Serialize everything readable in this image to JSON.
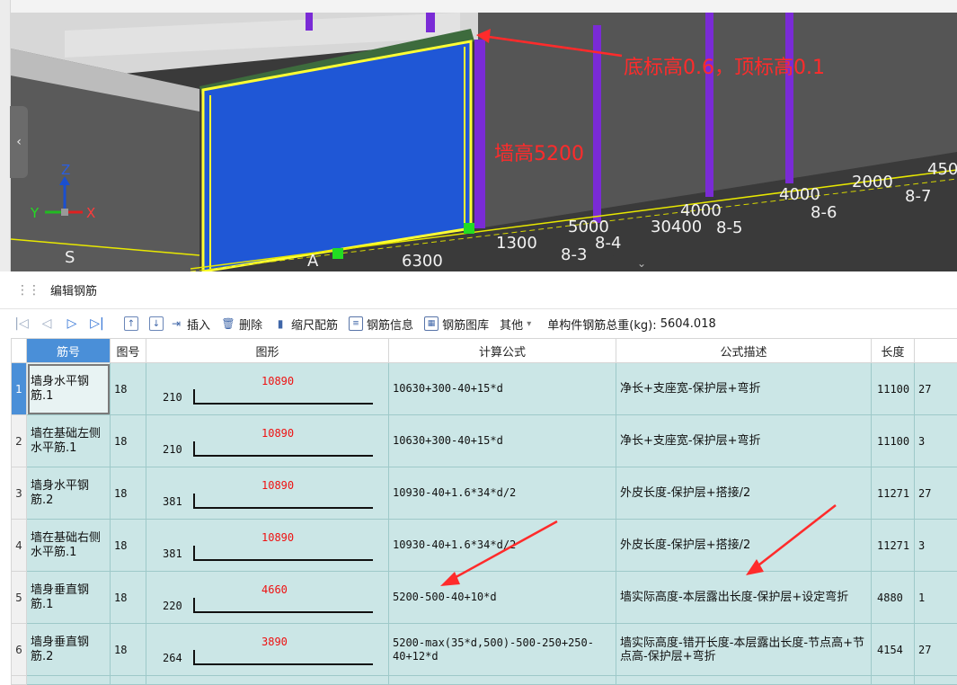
{
  "viewport": {
    "annotation_top_label": "底标高0.6，顶标高0.1",
    "annotation_wall_height": "墙高5200",
    "axes": {
      "z": "Z",
      "y": "Y",
      "x": "X"
    },
    "dimension_labels": [
      "6300",
      "1300",
      "5000",
      "30400",
      "4000",
      "4000",
      "2000",
      "450",
      "8-3",
      "8-4",
      "8-5",
      "8-6",
      "8-7",
      "A",
      "S"
    ],
    "collapse_glyph": "‹",
    "expand_glyph": "⌄",
    "colors": {
      "wall_face": "#1f57d6",
      "highlight_edge": "#ffff33",
      "column": "#7a2bd6",
      "annotation": "#ff2b2b",
      "ground": "#111111",
      "wall_top": "#3d6b3d"
    }
  },
  "panel": {
    "title": "编辑钢筋",
    "handle_glyph": "⋮⋮"
  },
  "toolbar": {
    "nav_first": "|◁",
    "nav_prev": "◁",
    "nav_next": "▷",
    "nav_last": "▷|",
    "move_up": "↑",
    "move_down": "↓",
    "insert": "插入",
    "delete": "删除",
    "scale_rebar": "缩尺配筋",
    "rebar_info": "钢筋信息",
    "rebar_library": "钢筋图库",
    "other": "其他",
    "other_caret": "▾",
    "total_weight_label": "单构件钢筋总重(kg):",
    "total_weight_value": "5604.018"
  },
  "grid": {
    "headers": [
      "筋号",
      "图号",
      "图形",
      "计算公式",
      "公式描述",
      "长度",
      ""
    ],
    "rows": [
      {
        "index": "1",
        "name": "墙身水平钢筋.1",
        "figure_no": "18",
        "shape_label": "210",
        "shape_length": "10890",
        "formula": "10630+300-40+15*d",
        "description": "净长+支座宽-保护层+弯折",
        "length": "11100",
        "count": "27"
      },
      {
        "index": "2",
        "name": "墙在基础左侧水平筋.1",
        "figure_no": "18",
        "shape_label": "210",
        "shape_length": "10890",
        "formula": "10630+300-40+15*d",
        "description": "净长+支座宽-保护层+弯折",
        "length": "11100",
        "count": "3"
      },
      {
        "index": "3",
        "name": "墙身水平钢筋.2",
        "figure_no": "18",
        "shape_label": "381",
        "shape_length": "10890",
        "formula": "10930-40+1.6*34*d/2",
        "description": "外皮长度-保护层+搭接/2",
        "length": "11271",
        "count": "27"
      },
      {
        "index": "4",
        "name": "墙在基础右侧水平筋.1",
        "figure_no": "18",
        "shape_label": "381",
        "shape_length": "10890",
        "formula": "10930-40+1.6*34*d/2",
        "description": "外皮长度-保护层+搭接/2",
        "length": "11271",
        "count": "3"
      },
      {
        "index": "5",
        "name": "墙身垂直钢筋.1",
        "figure_no": "18",
        "shape_label": "220",
        "shape_length": "4660",
        "formula": "5200-500-40+10*d",
        "description": "墙实际高度-本层露出长度-保护层+设定弯折",
        "length": "4880",
        "count": "1"
      },
      {
        "index": "6",
        "name": "墙身垂直钢筋.2",
        "figure_no": "18",
        "shape_label": "264",
        "shape_length": "3890",
        "formula": "5200-max(35*d,500)-500-250+250-40+12*d",
        "description": "墙实际高度-错开长度-本层露出长度-节点高+节点高-保护层+弯折",
        "length": "4154",
        "count": "27"
      }
    ]
  }
}
